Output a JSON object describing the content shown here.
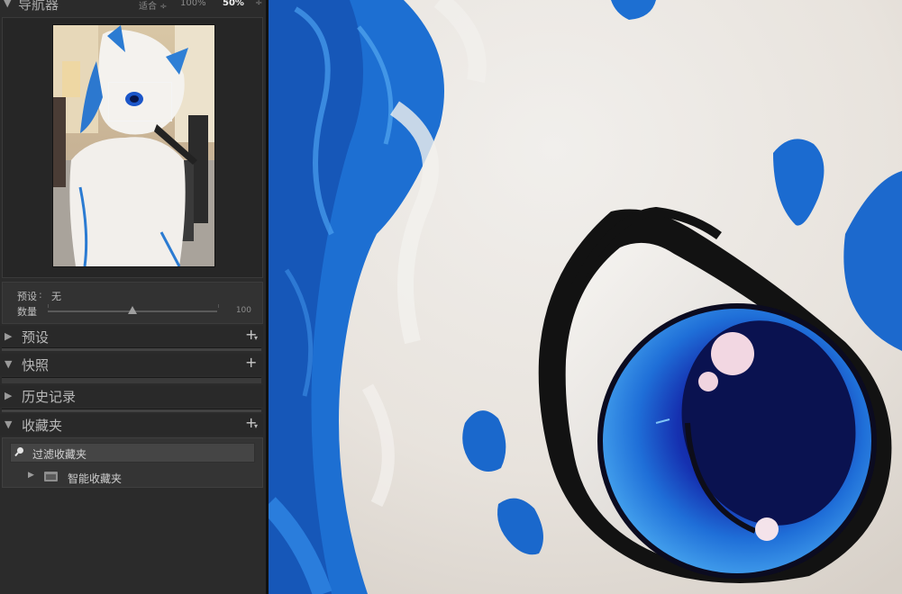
{
  "navigator": {
    "title": "导航器",
    "zoom_options": [
      {
        "label": "适合 ÷",
        "active": false
      },
      {
        "label": "100%",
        "active": false
      },
      {
        "label": "50%",
        "active": true
      },
      {
        "label": "÷",
        "active": false
      }
    ]
  },
  "quick_develop": {
    "preset_label": "预设",
    "preset_value": "无",
    "amount_label": "数量",
    "amount_value": "100",
    "amount_level": 0.5
  },
  "panels": {
    "presets": {
      "title": "预设",
      "add": "+"
    },
    "snapshots": {
      "title": "快照",
      "add": "+"
    },
    "history": {
      "title": "历史记录"
    },
    "collections": {
      "title": "收藏夹",
      "add": "+"
    }
  },
  "collections": {
    "filter_placeholder": "过滤收藏夹",
    "smart_collection": "智能收藏夹"
  },
  "colors": {
    "panel_bg": "#2b2b2b",
    "accent_blue": "#1f6fd8",
    "fur_white": "#eeeae6"
  }
}
